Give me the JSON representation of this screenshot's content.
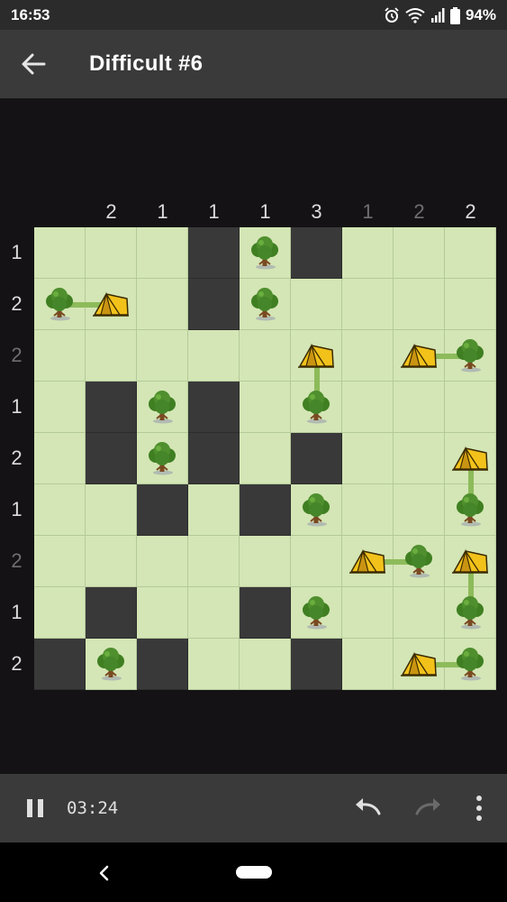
{
  "status_bar": {
    "time": "16:53",
    "battery": "94%",
    "icons": [
      "alarm-icon",
      "wifi-icon",
      "signal-icon",
      "battery-icon"
    ]
  },
  "app_bar": {
    "title": "Difficult #6",
    "back_icon": "arrow-left-icon"
  },
  "puzzle": {
    "size": 9,
    "column_clues": [
      {
        "value": "2",
        "satisfied": false
      },
      {
        "value": "1",
        "satisfied": false
      },
      {
        "value": "1",
        "satisfied": false
      },
      {
        "value": "1",
        "satisfied": false
      },
      {
        "value": "3",
        "satisfied": false
      },
      {
        "value": "1",
        "satisfied": true
      },
      {
        "value": "2",
        "satisfied": true
      },
      {
        "value": "2",
        "satisfied": false
      }
    ],
    "row_clues": [
      {
        "value": "1",
        "satisfied": false
      },
      {
        "value": "2",
        "satisfied": false
      },
      {
        "value": "2",
        "satisfied": true
      },
      {
        "value": "1",
        "satisfied": false
      },
      {
        "value": "2",
        "satisfied": false
      },
      {
        "value": "1",
        "satisfied": false
      },
      {
        "value": "2",
        "satisfied": true
      },
      {
        "value": "1",
        "satisfied": false
      },
      {
        "value": "2",
        "satisfied": false
      }
    ],
    "grid": [
      ". . . X T X . . .",
      "T t . X T . . . .",
      ". . . . . t . t T",
      ". X T X . T . . .",
      ". X T X . X . . t",
      ". . X . X T . . T",
      ". . . . . . t T t",
      ". X . . X T . . T",
      "X T X . . X . t T"
    ],
    "legend": {
      "T": "tree",
      "t": "tent",
      "X": "grass-marked",
      ".": "empty"
    },
    "links": [
      [
        [
          1,
          0
        ],
        [
          1,
          1
        ]
      ],
      [
        [
          2,
          5
        ],
        [
          3,
          5
        ]
      ],
      [
        [
          2,
          7
        ],
        [
          2,
          8
        ]
      ],
      [
        [
          4,
          8
        ],
        [
          5,
          8
        ]
      ],
      [
        [
          6,
          6
        ],
        [
          6,
          7
        ]
      ],
      [
        [
          6,
          8
        ],
        [
          7,
          8
        ]
      ],
      [
        [
          8,
          7
        ],
        [
          8,
          8
        ]
      ]
    ],
    "colors": {
      "cell": "#d4e6b5",
      "marked": "#393939",
      "link": "#8dbb5a",
      "tree_canopy": "#4f8f2e",
      "tent": "#f2c21b"
    }
  },
  "bottom_bar": {
    "timer": "03:24",
    "icons": [
      "pause-icon",
      "undo-icon",
      "redo-icon",
      "more-vert-icon"
    ]
  },
  "nav_bar": {
    "icons": [
      "nav-back-icon",
      "home-pill"
    ]
  }
}
